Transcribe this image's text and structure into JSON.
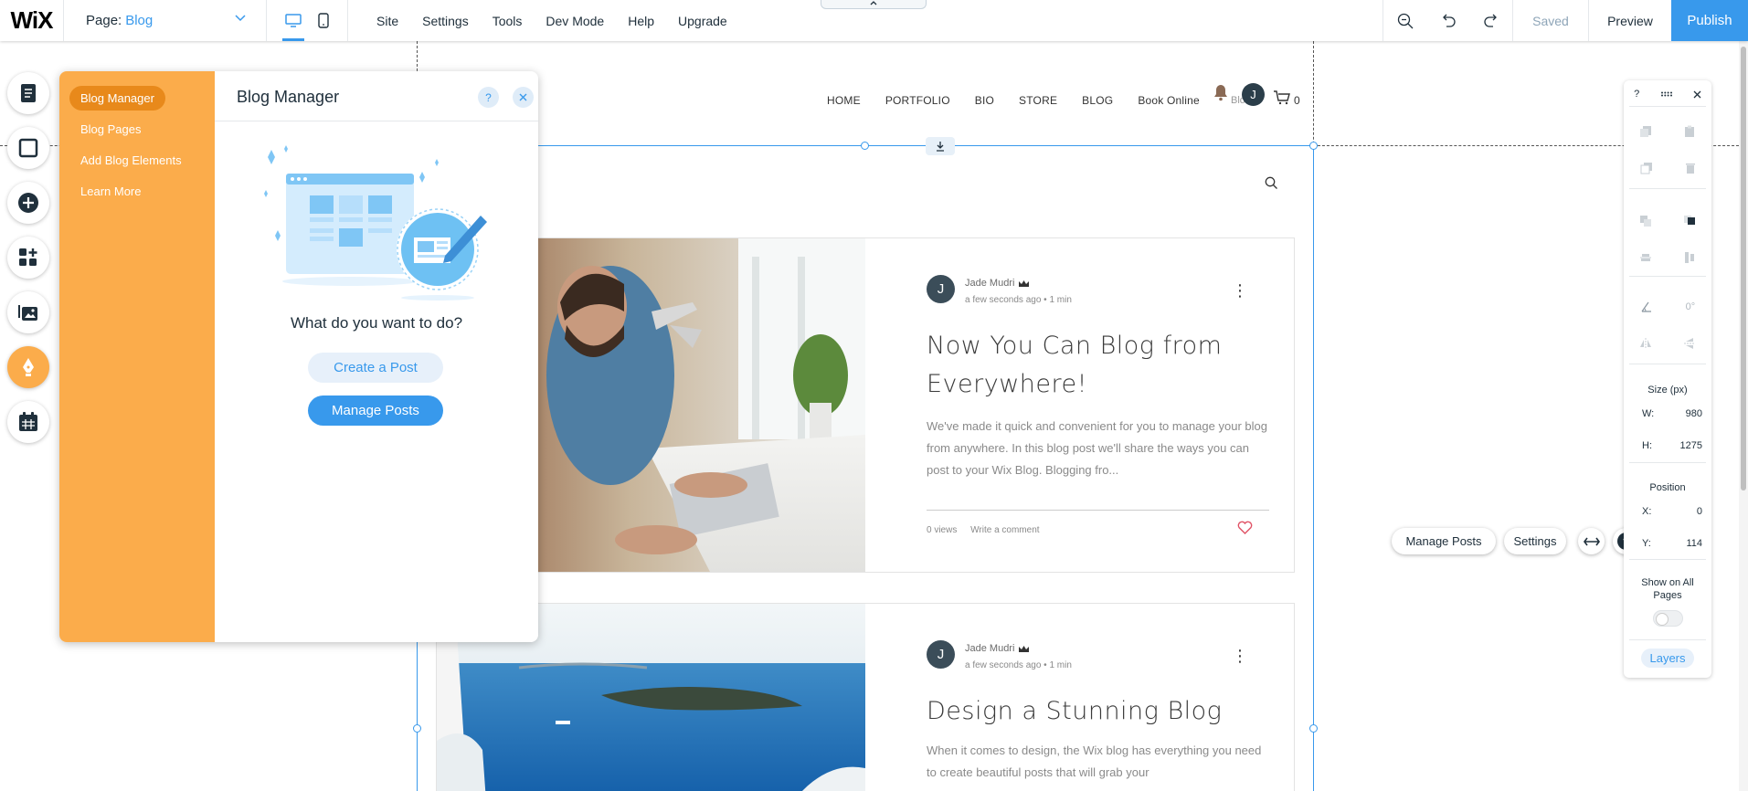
{
  "topbar": {
    "page_label": "Page:",
    "page_value": "Blog",
    "menu": [
      "Site",
      "Settings",
      "Tools",
      "Dev Mode",
      "Help",
      "Upgrade"
    ],
    "saved": "Saved",
    "preview": "Preview",
    "publish": "Publish"
  },
  "site": {
    "nav": [
      "HOME",
      "PORTFOLIO",
      "BIO",
      "STORE",
      "BLOG",
      "Book Online"
    ],
    "member_initial": "J",
    "nav_overflow": "Blo",
    "cart_count": "0"
  },
  "posts": [
    {
      "avatar": "J",
      "author": "Jade Mudri",
      "meta": "a few seconds ago  •  1 min",
      "title": "Now You Can Blog from Everywhere!",
      "excerpt": "We've made it quick and convenient for you to manage your blog from anywhere. In this blog post we'll share the ways you can post to your Wix Blog. Blogging fro...",
      "views": "0 views",
      "comment": "Write a comment"
    },
    {
      "avatar": "J",
      "author": "Jade Mudri",
      "meta": "a few seconds ago  •  1 min",
      "title": "Design a Stunning Blog",
      "excerpt": "When it comes to design, the Wix blog has everything you need to create beautiful posts that will grab your"
    }
  ],
  "blog_panel": {
    "title": "Blog Manager",
    "help": "?",
    "nav": [
      "Blog Manager",
      "Blog Pages",
      "Add Blog Elements",
      "Learn More"
    ],
    "question": "What do you want to do?",
    "create_post": "Create a Post",
    "manage_posts": "Manage Posts"
  },
  "element_toolbar": {
    "manage_posts": "Manage Posts",
    "settings": "Settings",
    "help": "?"
  },
  "properties": {
    "help": "?",
    "rotation": "0°",
    "size_label": "Size (px)",
    "w_label": "W:",
    "w_value": "980",
    "h_label": "H:",
    "h_value": "1275",
    "position_label": "Position",
    "x_label": "X:",
    "x_value": "0",
    "y_label": "Y:",
    "y_value": "114",
    "show_all_pages": "Show on All Pages",
    "layers": "Layers"
  },
  "colors": {
    "accent": "#3899ec",
    "panel_orange": "#fbac4b",
    "panel_orange_active": "#e8891b"
  }
}
